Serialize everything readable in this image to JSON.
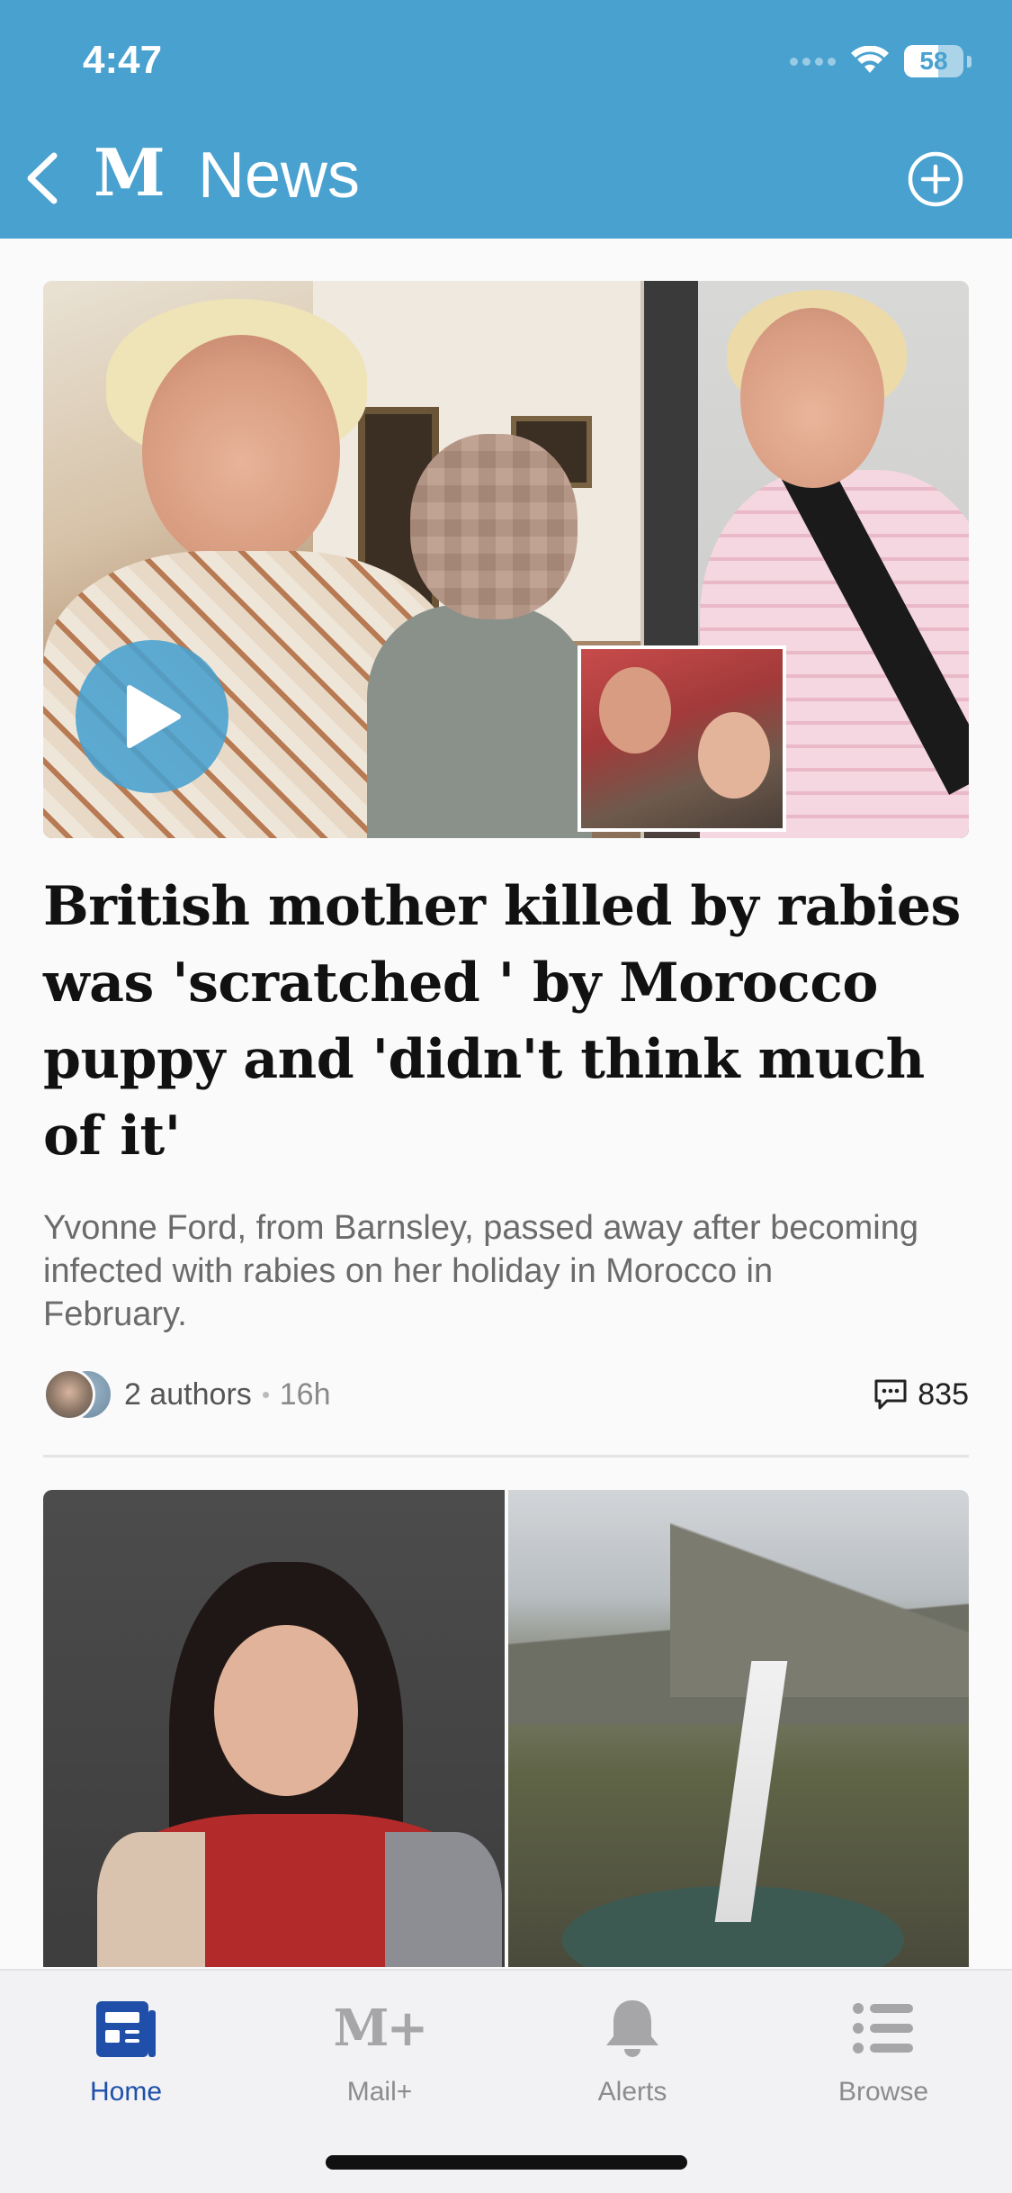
{
  "status_bar": {
    "time": "4:47",
    "battery_level": "58",
    "battery_fraction": 0.58
  },
  "nav": {
    "logo": "M",
    "title": "News",
    "back_icon": "chevron-left-icon",
    "add_icon": "plus-circle-icon"
  },
  "article_1": {
    "headline": "British mother killed by rabies was 'scratched ' by Morocco puppy and 'didn't think much of it'",
    "standfirst": "Yvonne Ford, from Barnsley, passed away after becoming infected with rabies on her holiday in Morocco in February.",
    "authors": "2 authors",
    "time_ago": "16h",
    "comment_count": "835",
    "has_video": true
  },
  "tabbar": {
    "items": [
      {
        "label": "Home",
        "icon": "newspaper-icon",
        "active": true
      },
      {
        "label": "Mail+",
        "icon": "mail-plus-icon",
        "icon_text": "M+",
        "active": false
      },
      {
        "label": "Alerts",
        "icon": "bell-icon",
        "active": false
      },
      {
        "label": "Browse",
        "icon": "list-icon",
        "active": false
      }
    ]
  },
  "colors": {
    "header_bg": "#48a1cf",
    "active_tab": "#1f4fa8",
    "inactive_tab": "#8c8c8f"
  }
}
